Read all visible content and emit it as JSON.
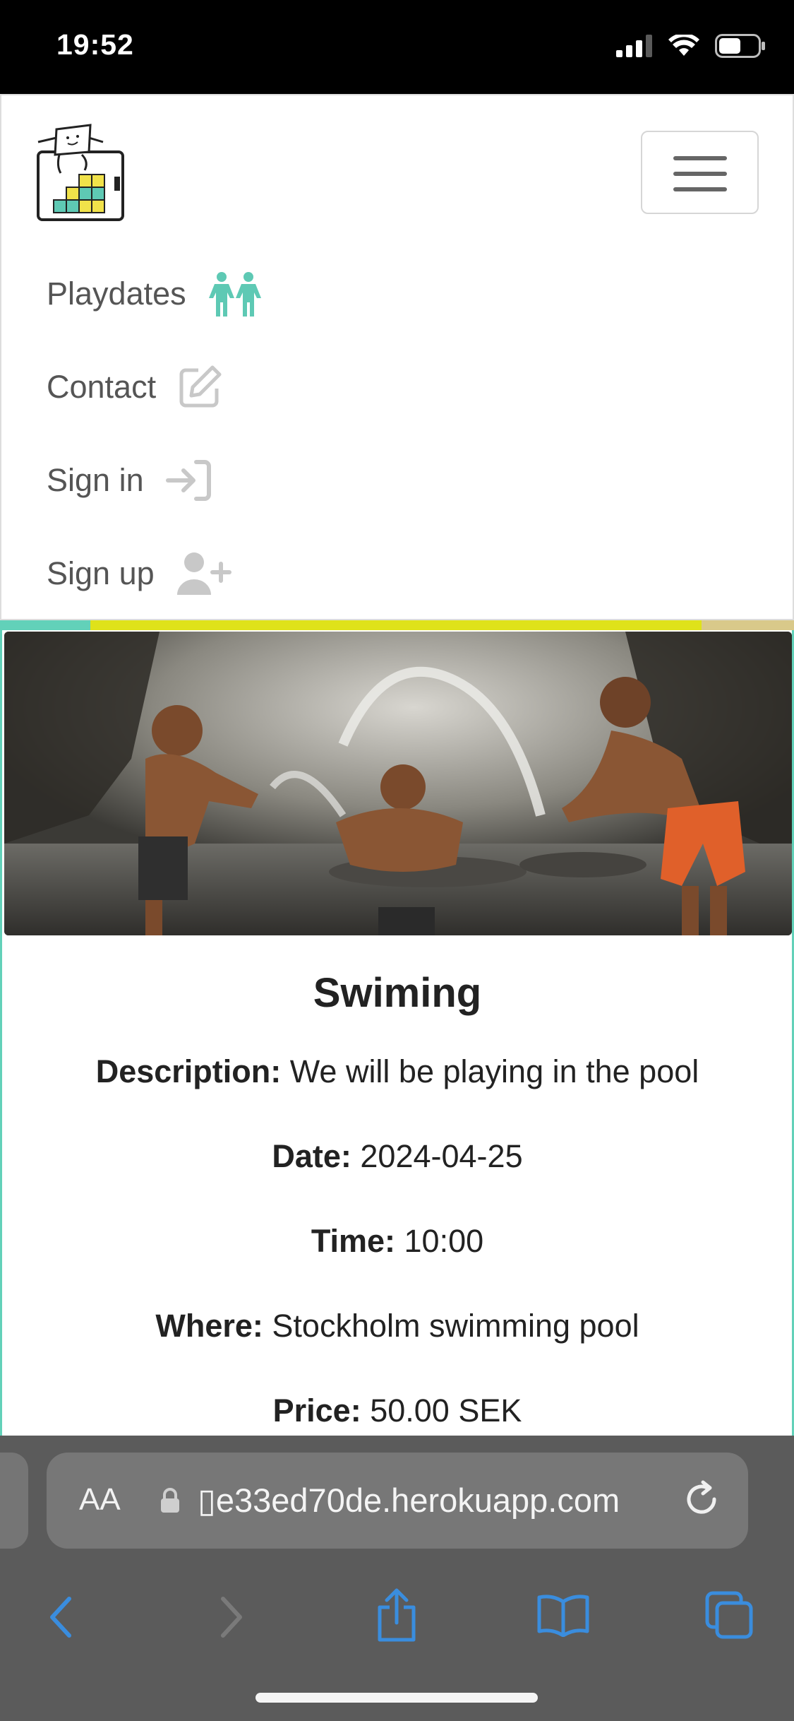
{
  "status_bar": {
    "time": "19:52"
  },
  "nav": {
    "items": [
      {
        "label": "Playdates",
        "icon": "children-icon",
        "color": "#5ec9b4"
      },
      {
        "label": "Contact",
        "icon": "edit-icon",
        "color": "#c8c8c8"
      },
      {
        "label": "Sign in",
        "icon": "sign-in-icon",
        "color": "#c8c8c8"
      },
      {
        "label": "Sign up",
        "icon": "user-plus-icon",
        "color": "#c8c8c8"
      }
    ]
  },
  "card": {
    "title": "Swiming",
    "rows": [
      {
        "label": "Description:",
        "value": " We will be playing in the pool"
      },
      {
        "label": "Date:",
        "value": " 2024-04-25"
      },
      {
        "label": "Time:",
        "value": " 10:00"
      },
      {
        "label": "Where:",
        "value": " Stockholm swimming pool"
      },
      {
        "label": "Price:",
        "value": " 50.00 SEK"
      }
    ]
  },
  "browser": {
    "aa_label": "AA",
    "url": "▯e33ed70de.herokuapp.com"
  },
  "colors": {
    "accent_teal": "#62d1b9",
    "accent_yellow": "#dfe21a",
    "safari_blue": "#3a8dde"
  }
}
